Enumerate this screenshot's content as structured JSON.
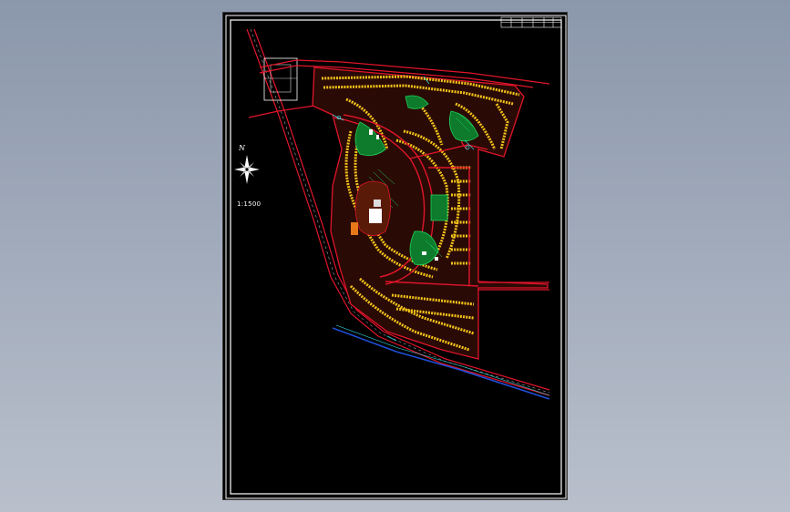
{
  "drawing": {
    "scale_label": "1:1500",
    "north_label": "N",
    "background": "#000000",
    "frame_color": "#ffffff",
    "road_color": "#e0152a",
    "building_color": "#f3c419",
    "green_color": "#1fd35a",
    "water_color": "#1f4fd8",
    "cyan_color": "#35e0e8"
  }
}
